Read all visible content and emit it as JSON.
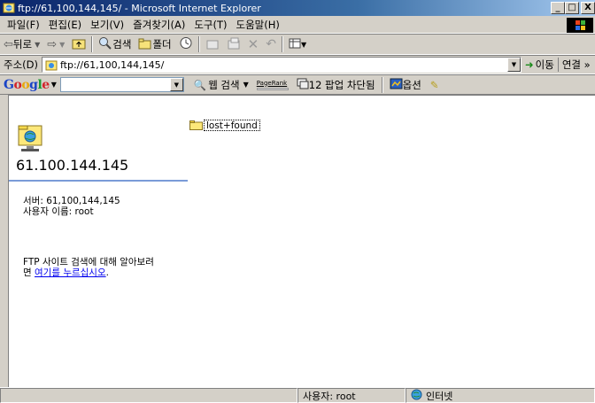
{
  "window": {
    "title": "ftp://61,100,144,145/ - Microsoft Internet Explorer",
    "buttons": [
      "_",
      "□",
      "X"
    ]
  },
  "menu": [
    "파일(F)",
    "편집(E)",
    "보기(V)",
    "즐겨찾기(A)",
    "도구(T)",
    "도움말(H)"
  ],
  "toolbar": {
    "back_label": "뒤로",
    "search_label": "검색",
    "folders_label": "폴더",
    "view_label": "▼"
  },
  "address": {
    "label": "주소(D)",
    "value": "ftp://61,100,144,145/",
    "go_label": "이동",
    "links_label": "연결 »"
  },
  "googlebar": {
    "logo": "Google",
    "search_value": "",
    "web_search_label": "웹 검색",
    "pagerank_label": "PageRank",
    "popup_label": "12 팝업 차단됨",
    "options_label": "옵션"
  },
  "content": {
    "server_name": "61.100.144.145",
    "server_line": "서버: 61,100,144,145",
    "user_line": "사용자 이름: root",
    "help_line1": "FTP 사이트 검색에 대해 알아보려",
    "help_line2_prefix": "면 ",
    "help_link": "여기를 누르십시오",
    "help_line2_suffix": ".",
    "files": [
      {
        "name": "lost+found",
        "type": "folder"
      }
    ]
  },
  "status": {
    "message": "",
    "user": "사용자: root",
    "zone": "인터넷"
  },
  "colors": {
    "title_gradient_start": "#0a246a",
    "title_gradient_end": "#a6caf0",
    "chrome": "#d4d0c8",
    "link": "#0000ee"
  }
}
